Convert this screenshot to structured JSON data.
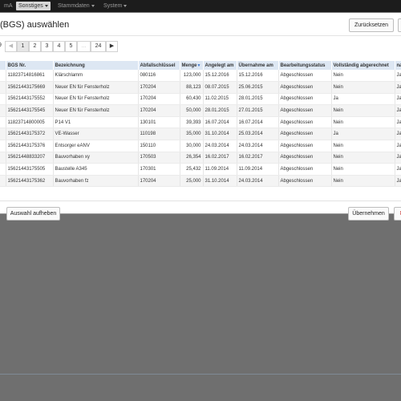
{
  "navbar": {
    "items": [
      {
        "label": "mA",
        "active": false
      },
      {
        "label": "Sonstiges",
        "active": true
      },
      {
        "label": "Stammdaten",
        "active": false
      },
      {
        "label": "System",
        "active": false
      }
    ]
  },
  "modal": {
    "title": "(BGS) auswählen",
    "reset_label": "Zurücksetzen",
    "select_all_label": "Auswahl aufheben",
    "apply_label": "Übernehmen"
  },
  "pager": {
    "prev": "◀",
    "pages": [
      "1",
      "2",
      "3",
      "4",
      "5",
      "...",
      "24"
    ],
    "next": "▶",
    "partial_count": "9"
  },
  "table": {
    "columns": [
      "BGS Nr.",
      "Bezeichnung",
      "Abfallschlüssel",
      "Menge",
      "Angelegt am",
      "Übernahme am",
      "Bearbeitungsstatus",
      "Vollständig abgerechnet",
      "na"
    ],
    "rows": [
      [
        "11823714816861",
        "Klärschlamm",
        "080116",
        "123,000",
        "15.12.2016",
        "15.12.2016",
        "Abgeschlossen",
        "Nein",
        "Ja"
      ],
      [
        "15621443175669",
        "Neuer EN für Fensterholz",
        "170204",
        "88,123",
        "08.07.2015",
        "25.06.2015",
        "Abgeschlossen",
        "Nein",
        "Ja"
      ],
      [
        "15621443175552",
        "Neuer EN für Fensterholz",
        "170204",
        "60,430",
        "11.02.2015",
        "28.01.2015",
        "Abgeschlossen",
        "Ja",
        "Ja"
      ],
      [
        "15621443175545",
        "Neuer EN für Fensterholz",
        "170204",
        "50,000",
        "28.01.2015",
        "27.01.2015",
        "Abgeschlossen",
        "Nein",
        "Ja"
      ],
      [
        "11823714800005",
        "P14 V1",
        "130101",
        "39,393",
        "16.07.2014",
        "16.07.2014",
        "Abgeschlossen",
        "Nein",
        "Ja"
      ],
      [
        "15621443175372",
        "VE-Wasser",
        "110198",
        "35,000",
        "31.10.2014",
        "25.03.2014",
        "Abgeschlossen",
        "Ja",
        "Ja"
      ],
      [
        "15621443175376",
        "Entsorger eANV",
        "150110",
        "30,000",
        "24.03.2014",
        "24.03.2014",
        "Abgeschlossen",
        "Nein",
        "Ja"
      ],
      [
        "15621448833207",
        "Bauvorhaben xy",
        "170503",
        "26,354",
        "16.02.2017",
        "16.02.2017",
        "Abgeschlossen",
        "Nein",
        "Ja"
      ],
      [
        "15621443175505",
        "Baustelle A345",
        "170301",
        "25,432",
        "11.09.2014",
        "11.09.2014",
        "Abgeschlossen",
        "Nein",
        "Ja"
      ],
      [
        "15621443175362",
        "Bauvorhaben fz",
        "170204",
        "25,000",
        "31.10.2014",
        "24.03.2014",
        "Abgeschlossen",
        "Nein",
        "Ja"
      ]
    ],
    "row_prefixes": [
      "0",
      "9",
      "2",
      "5",
      "5",
      "2",
      "6",
      "7",
      "5",
      "2"
    ]
  }
}
